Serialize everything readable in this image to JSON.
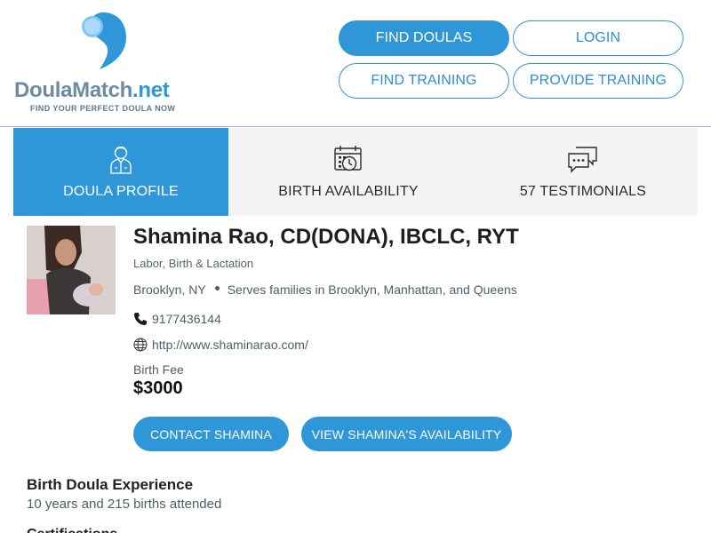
{
  "brand": {
    "name_part1": "Doula",
    "name_part2": "Match",
    "name_part3": ".net",
    "tagline": "FIND YOUR PERFECT DOULA NOW",
    "colors": {
      "primary": "#2f97d8",
      "slate": "#6d8ca4"
    }
  },
  "nav": {
    "find_doulas": "FIND DOULAS",
    "login": "LOGIN",
    "find_training": "FIND TRAINING",
    "provide_training": "PROVIDE TRAINING"
  },
  "tabs": [
    {
      "label": "DOULA PROFILE",
      "icon": "doula-person-icon",
      "active": true
    },
    {
      "label": "BIRTH AVAILABILITY",
      "icon": "calendar-clock-icon",
      "active": false
    },
    {
      "label": "57 TESTIMONIALS",
      "icon": "chat-bubbles-icon",
      "active": false
    }
  ],
  "profile": {
    "name": "Shamina Rao, CD(DONA), IBCLC, RYT",
    "specialty": "Labor, Birth & Lactation",
    "city": "Brooklyn, NY",
    "serves": "Serves families in Brooklyn, Manhattan, and Queens",
    "phone": "9177436144",
    "website": "http://www.shaminarao.com/",
    "fee_label": "Birth Fee",
    "fee_value": "$3000"
  },
  "actions": {
    "contact": "CONTACT SHAMINA",
    "availability": "VIEW SHAMINA'S AVAILABILITY"
  },
  "experience": {
    "title": "Birth Doula Experience",
    "text": "10 years and 215 births attended"
  },
  "next_section": {
    "title": "Certifications"
  }
}
